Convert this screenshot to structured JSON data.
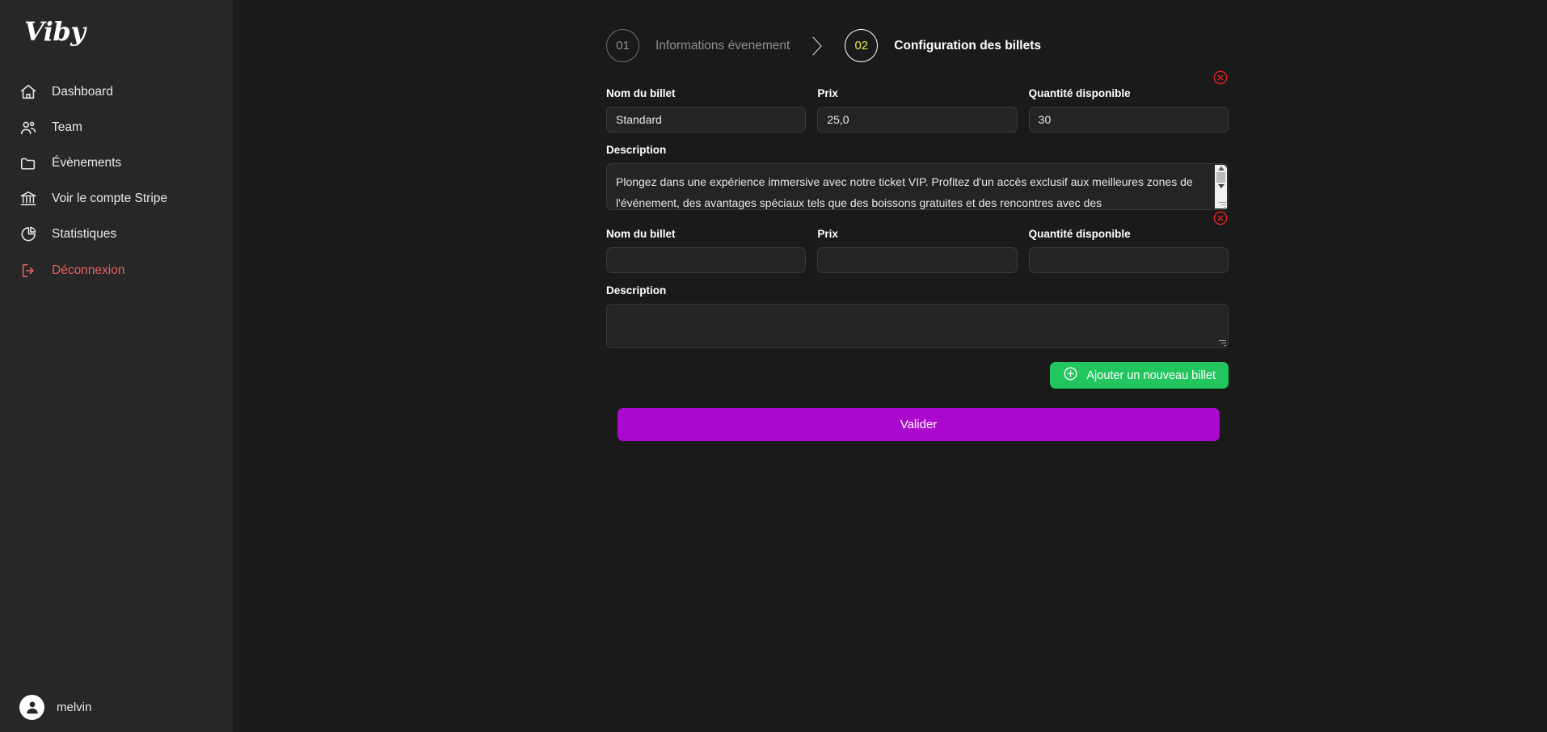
{
  "brand": {
    "logo_text": "Viby"
  },
  "sidebar": {
    "items": [
      {
        "label": "Dashboard",
        "icon": "home-icon"
      },
      {
        "label": "Team",
        "icon": "users-icon"
      },
      {
        "label": "Évènements",
        "icon": "folder-icon"
      },
      {
        "label": "Voir le compte Stripe",
        "icon": "bank-icon"
      },
      {
        "label": "Statistiques",
        "icon": "pie-chart-icon"
      },
      {
        "label": "Déconnexion",
        "icon": "logout-icon"
      }
    ],
    "profile": {
      "name": "melvin",
      "avatar_icon": "user-avatar-icon"
    }
  },
  "stepper": {
    "steps": [
      {
        "number": "01",
        "label": "Informations évenement",
        "active": false
      },
      {
        "number": "02",
        "label": "Configuration des billets",
        "active": true
      }
    ],
    "separator_icon": "chevron-right-icon"
  },
  "form": {
    "labels": {
      "name": "Nom du billet",
      "price": "Prix",
      "quantity": "Quantité disponible",
      "description": "Description"
    },
    "tickets": [
      {
        "name_value": "Standard",
        "price_value": "25,0",
        "quantity_value": "30",
        "description_value": "Plongez dans une expérience immersive avec notre ticket VIP. Profitez d'un accès exclusif aux meilleures zones de l'événement, des avantages spéciaux tels que des boissons gratuites et des rencontres avec des",
        "remove_icon": "remove-circle-icon"
      },
      {
        "name_value": "",
        "price_value": "",
        "quantity_value": "",
        "description_value": "",
        "remove_icon": "remove-circle-icon"
      }
    ],
    "placeholders": {
      "name": "",
      "price": "",
      "quantity": "",
      "description": ""
    },
    "add_button": {
      "label": "Ajouter un nouveau billet",
      "icon": "plus-circle-icon"
    },
    "validate_button": {
      "label": "Valider"
    }
  },
  "colors": {
    "page_bg": "#1a1a1a",
    "sidebar_bg": "#272727",
    "accent_green": "#22c55e",
    "accent_purple": "#ab09ce",
    "accent_yellow": "#e7ec4a",
    "accent_red": "#e8615f",
    "remove_red": "#e02424"
  }
}
